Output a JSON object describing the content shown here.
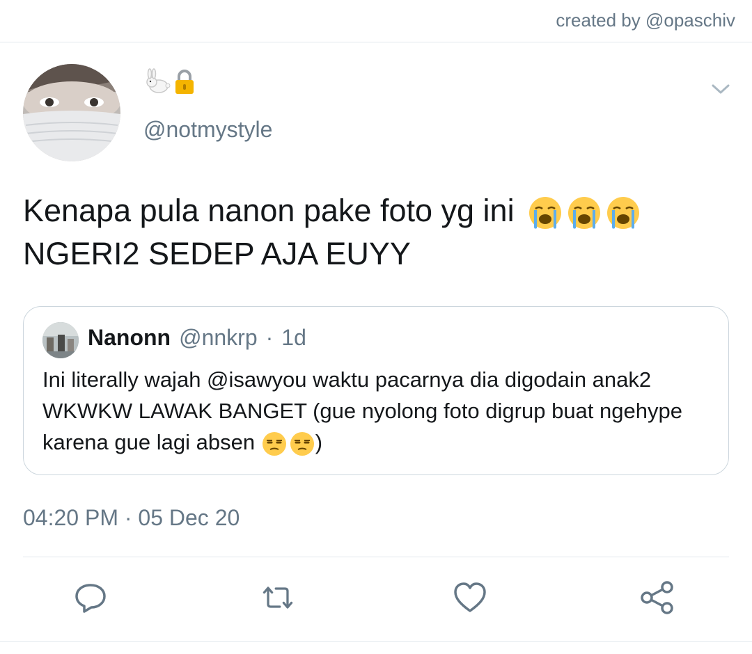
{
  "credit": "created by @opaschiv",
  "tweet": {
    "display_name_emojis": [
      "rabbit-emoji",
      "lock-emoji"
    ],
    "handle": "@notmystyle",
    "text_line1": "Kenapa pula nanon pake foto yg ini",
    "text_line2": "NGERI2 SEDEP AJA EUYY",
    "text_emojis": [
      "loudly-crying-face-emoji",
      "loudly-crying-face-emoji",
      "loudly-crying-face-emoji"
    ],
    "timestamp": "04:20 PM · 05 Dec 20"
  },
  "quote": {
    "name": "Nanonn",
    "handle": "@nnkrp",
    "separator": "·",
    "time": "1d",
    "text": "Ini literally wajah @isawyou waktu pacarnya dia digodain anak2 WKWKW LAWAK BANGET (gue nyolong foto digrup buat ngehype karena gue lagi absen",
    "text_end": ")",
    "emojis": [
      "unamused-face-emoji",
      "unamused-face-emoji"
    ]
  },
  "actions": [
    "reply",
    "retweet",
    "like",
    "share"
  ],
  "colors": {
    "text": "#14171a",
    "secondary": "#657786",
    "border": "#ccd6dd",
    "icon": "#657786"
  }
}
